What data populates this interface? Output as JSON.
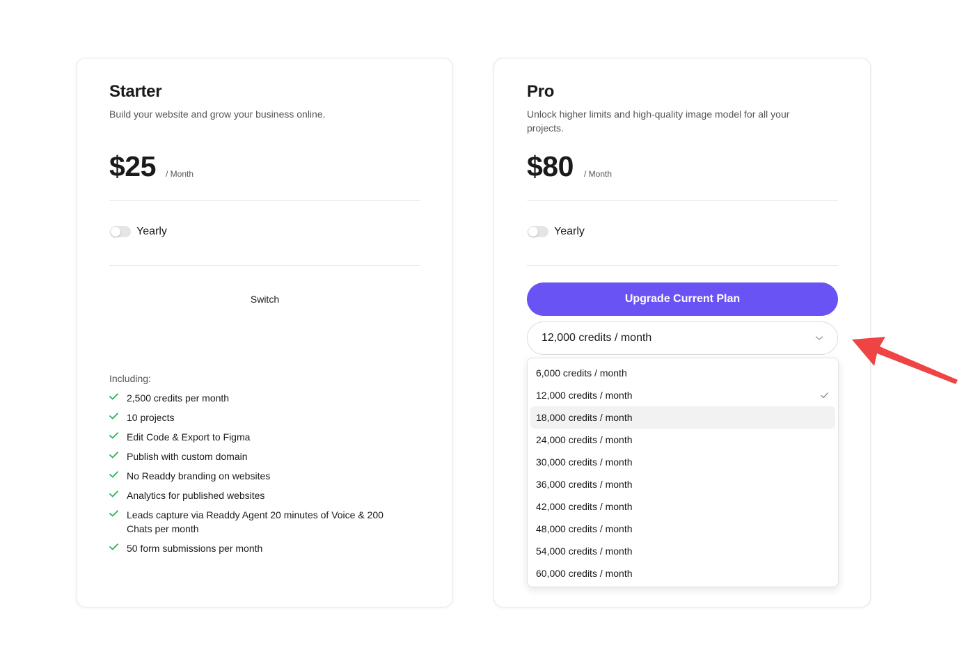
{
  "starter": {
    "title": "Starter",
    "description": "Build your website and grow your business online.",
    "price": "$25",
    "period": "/ Month",
    "yearly_label": "Yearly",
    "yearly_on": false,
    "switch_label": "Switch",
    "including_label": "Including:",
    "features": [
      "2,500 credits per month",
      "10 projects",
      "Edit Code & Export to Figma",
      "Publish with custom domain",
      "No Readdy branding on websites",
      "Analytics for published websites",
      "Leads capture via Readdy Agent 20 minutes of Voice & 200 Chats per month",
      "50 form submissions per month"
    ]
  },
  "pro": {
    "title": "Pro",
    "description": "Unlock higher limits and high-quality image model for all your projects.",
    "price": "$80",
    "period": "/ Month",
    "yearly_label": "Yearly",
    "yearly_on": false,
    "upgrade_label": "Upgrade Current Plan",
    "selected_credits": "12,000 credits / month",
    "credit_options": [
      "6,000 credits / month",
      "12,000 credits / month",
      "18,000 credits / month",
      "24,000 credits / month",
      "30,000 credits / month",
      "36,000 credits / month",
      "42,000 credits / month",
      "48,000 credits / month",
      "54,000 credits / month",
      "60,000 credits / month"
    ]
  },
  "colors": {
    "accent": "#6a53f5",
    "check": "#22b35e",
    "annotation_arrow": "#ee4444"
  }
}
